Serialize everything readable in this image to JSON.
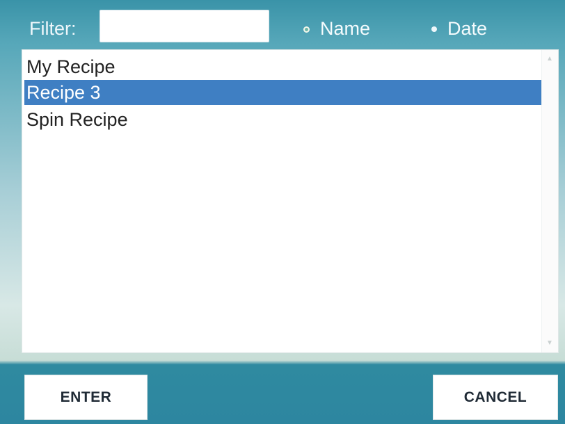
{
  "dialog": {
    "filter": {
      "label": "Filter:",
      "value": "",
      "placeholder": ""
    },
    "sort_options": {
      "name_label": "Name",
      "date_label": "Date",
      "selected": "Name"
    },
    "list": {
      "items": [
        {
          "label": "My Recipe",
          "selected": false
        },
        {
          "label": "Recipe 3",
          "selected": true
        },
        {
          "label": "Spin Recipe",
          "selected": false
        }
      ]
    },
    "buttons": {
      "enter_label": "ENTER",
      "cancel_label": "CANCEL"
    }
  }
}
